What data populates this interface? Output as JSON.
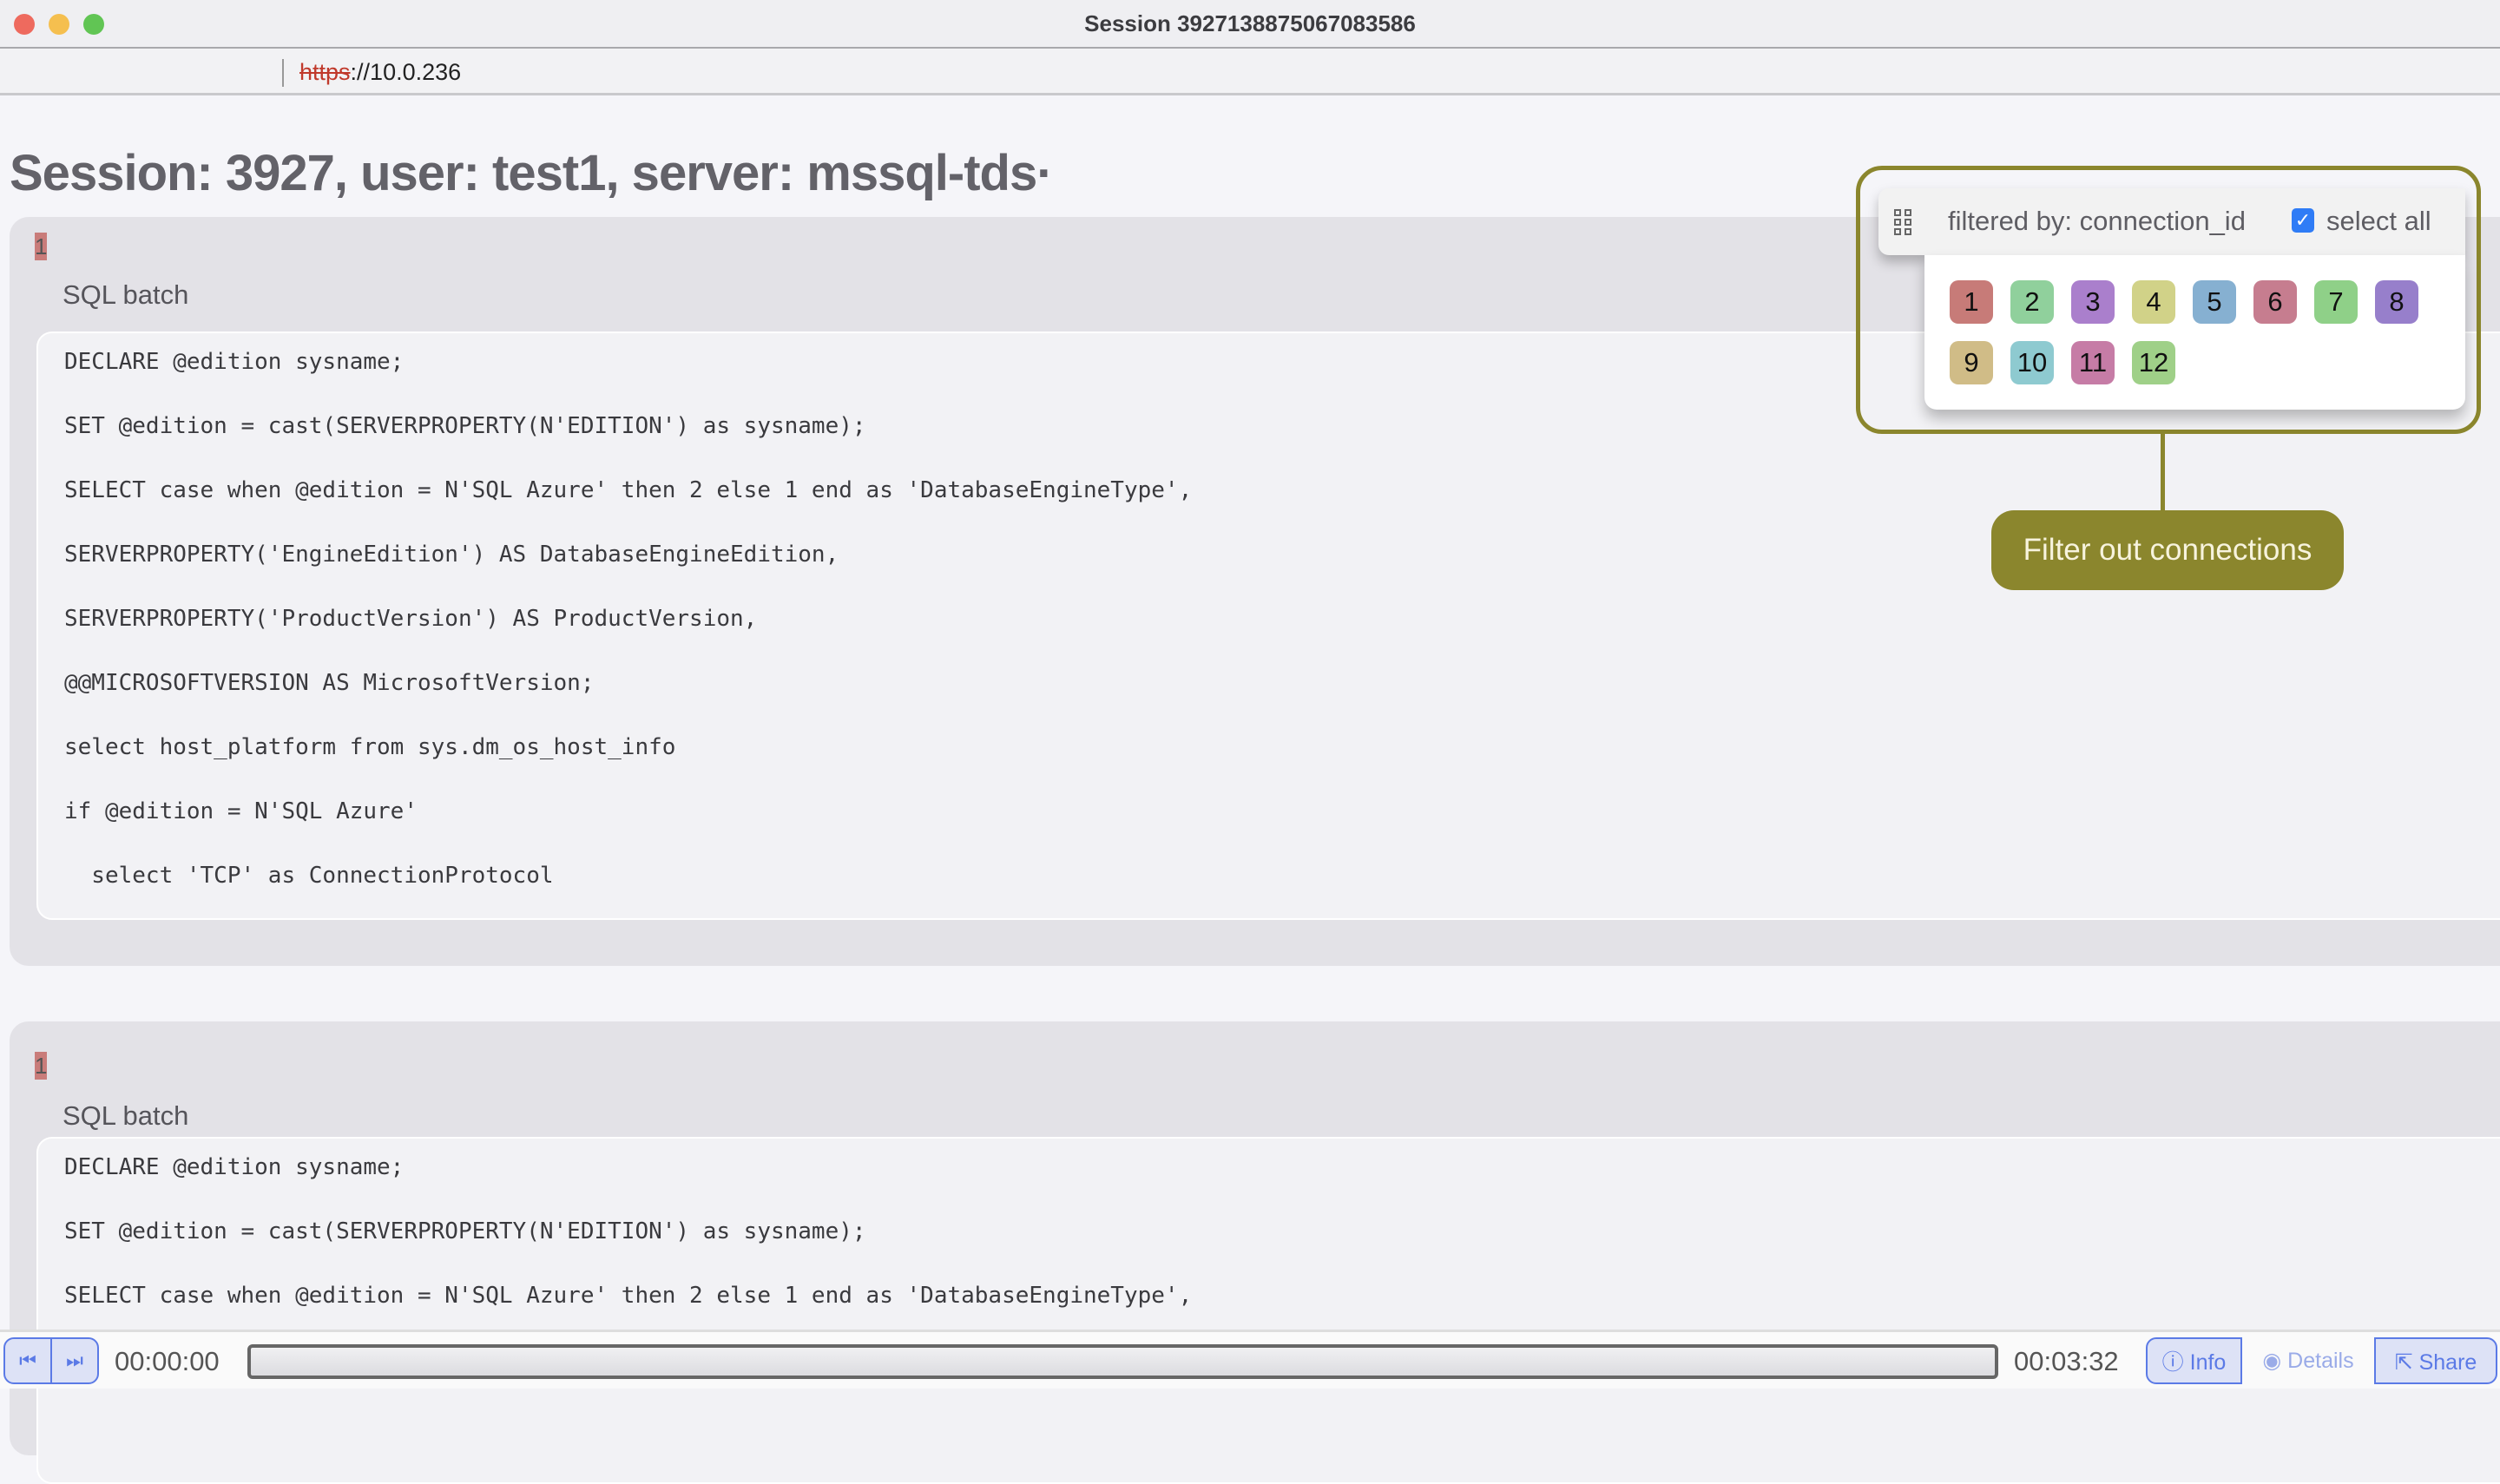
{
  "window": {
    "title": "Session 3927138875067083586"
  },
  "address": {
    "scheme": "https",
    "rest": "://10.0.236"
  },
  "page": {
    "heading": "Session: 3927, user: test1, server: mssql-tds·"
  },
  "blocks": [
    {
      "badge": "1",
      "title": "SQL batch",
      "lines": [
        "DECLARE @edition sysname;",
        "SET @edition = cast(SERVERPROPERTY(N'EDITION') as sysname);",
        "SELECT case when @edition = N'SQL Azure' then 2 else 1 end as 'DatabaseEngineType',",
        "SERVERPROPERTY('EngineEdition') AS DatabaseEngineEdition,",
        "SERVERPROPERTY('ProductVersion') AS ProductVersion,",
        "@@MICROSOFTVERSION AS MicrosoftVersion;",
        "select host_platform from sys.dm_os_host_info",
        "if @edition = N'SQL Azure'",
        "  select 'TCP' as ConnectionProtocol"
      ]
    },
    {
      "badge": "1",
      "title": "SQL batch",
      "lines": [
        "DECLARE @edition sysname;",
        "SET @edition = cast(SERVERPROPERTY(N'EDITION') as sysname);",
        "SELECT case when @edition = N'SQL Azure' then 2 else 1 end as 'DatabaseEngineType',"
      ]
    }
  ],
  "filter": {
    "label": "filtered by: connection_id",
    "select_all": "select all",
    "select_all_checked": true,
    "connections": [
      {
        "id": "1",
        "color": "#c77b78"
      },
      {
        "id": "2",
        "color": "#90d09c"
      },
      {
        "id": "3",
        "color": "#aa7fcc"
      },
      {
        "id": "4",
        "color": "#d1d288"
      },
      {
        "id": "5",
        "color": "#86b0d1"
      },
      {
        "id": "6",
        "color": "#c67d8f"
      },
      {
        "id": "7",
        "color": "#8fd088"
      },
      {
        "id": "8",
        "color": "#977fcb"
      },
      {
        "id": "9",
        "color": "#d0bc87"
      },
      {
        "id": "10",
        "color": "#8ecad0"
      },
      {
        "id": "11",
        "color": "#c67ca6"
      },
      {
        "id": "12",
        "color": "#9fd088"
      }
    ]
  },
  "annotation": {
    "label": "Filter out connections",
    "color": "#8b862d"
  },
  "player": {
    "current_time": "00:00:00",
    "total_time": "00:03:32",
    "progress": 0,
    "info": "Info",
    "details": "Details",
    "share": "Share"
  }
}
